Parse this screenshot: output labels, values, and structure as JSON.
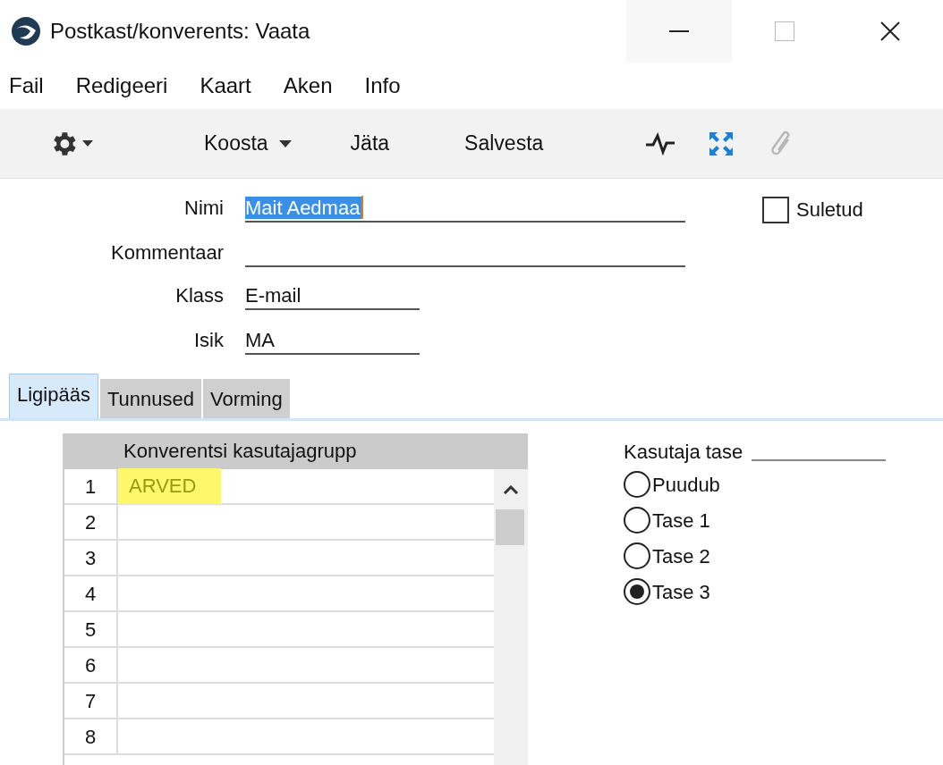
{
  "window": {
    "title": "Postkast/konverents: Vaata"
  },
  "menu": [
    "Fail",
    "Redigeeri",
    "Kaart",
    "Aken",
    "Info"
  ],
  "toolbar": {
    "buttons": [
      {
        "kind": "dropdown",
        "label": "Koosta"
      },
      {
        "kind": "plain",
        "label": "Jäta"
      },
      {
        "kind": "plain",
        "label": "Salvesta"
      }
    ]
  },
  "fields": [
    {
      "label": "Nimi",
      "value": "Mait Aedmaa",
      "selected": true,
      "kind": "wide"
    },
    {
      "label": "Kommentaar",
      "selected": false,
      "kind": "wide"
    },
    {
      "label": "Klass",
      "value": "E-mail",
      "selected": false,
      "kind": "short"
    },
    {
      "label": "Isik",
      "value": "MA",
      "selected": false,
      "kind": "short"
    }
  ],
  "closed": {
    "label": "Suletud",
    "checked": false
  },
  "tabs": [
    {
      "label": "Ligipääs",
      "selected": true
    },
    {
      "label": "Tunnused",
      "selected": false
    },
    {
      "label": "Vorming",
      "selected": false
    }
  ],
  "table": {
    "columns": [
      "Konverentsi kasutajagrupp"
    ],
    "rows": [
      {
        "number": "1",
        "value": "ARVED",
        "highlighted": true
      },
      {
        "number": "2",
        "highlighted": false
      },
      {
        "number": "3",
        "highlighted": false
      },
      {
        "number": "4",
        "highlighted": false
      },
      {
        "number": "5",
        "highlighted": false
      },
      {
        "number": "6",
        "highlighted": false
      },
      {
        "number": "7",
        "highlighted": false
      },
      {
        "number": "8",
        "highlighted": false
      }
    ]
  },
  "user_level": {
    "label": "Kasutaja tase",
    "options": [
      {
        "label": "Puudub",
        "selected": false
      },
      {
        "label": "Tase 1",
        "selected": false
      },
      {
        "label": "Tase 2",
        "selected": false
      },
      {
        "label": "Tase 3",
        "selected": true
      }
    ]
  }
}
